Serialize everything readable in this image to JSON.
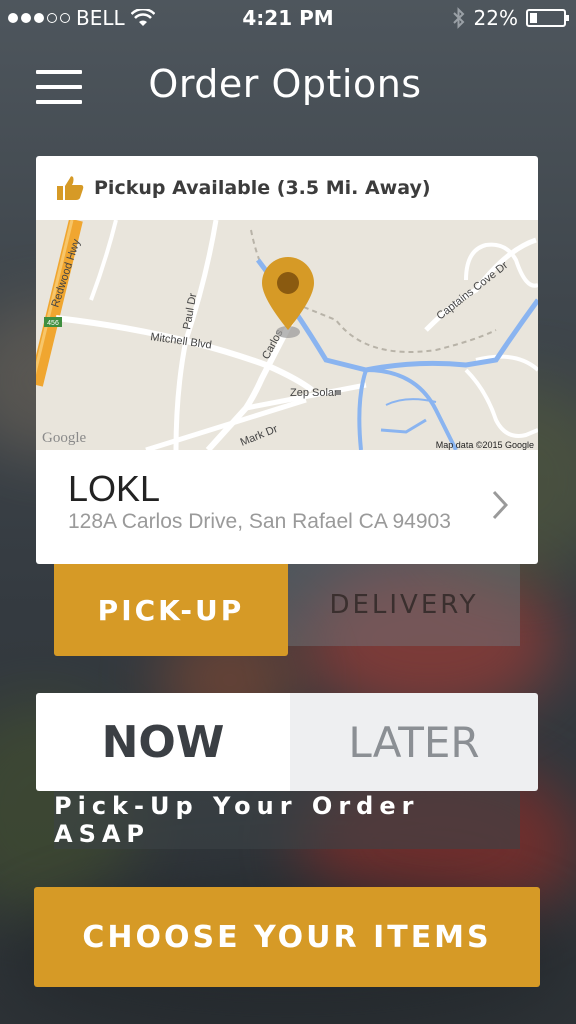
{
  "status_bar": {
    "carrier": "BELL",
    "time": "4:21 PM",
    "battery": "22%",
    "battery_level": 0.22,
    "signal_bars_filled": 3,
    "signal_bars_total": 5
  },
  "header": {
    "title": "Order Options",
    "menu_icon": "hamburger-menu-icon"
  },
  "location_card": {
    "availability": "Pickup Available (3.5 Mi. Away)",
    "availability_icon": "thumbs-up-icon",
    "map": {
      "streets": [
        "Redwood Hwy",
        "Mitchell Blvd",
        "Paul Dr",
        "Carlos",
        "Mark Dr",
        "Captains Cove Dr"
      ],
      "poi": "Zep Solar",
      "highway_shield": "456",
      "logo": "Google",
      "attribution": "Map data ©2015 Google",
      "pin_icon": "map-pin-icon"
    },
    "name": "LOKL",
    "address": "128A Carlos Drive, San Rafael CA 94903"
  },
  "order_type": {
    "options": [
      "PICK-UP",
      "DELIVERY"
    ],
    "selected": "PICK-UP"
  },
  "timing": {
    "options": [
      "NOW",
      "LATER"
    ],
    "selected": "NOW",
    "message": "Pick-Up Your Order ASAP"
  },
  "cta": {
    "label": "CHOOSE YOUR ITEMS"
  },
  "colors": {
    "accent": "#d69a26",
    "map_water": "#8ab4f0",
    "map_land": "#e9e5dc"
  }
}
